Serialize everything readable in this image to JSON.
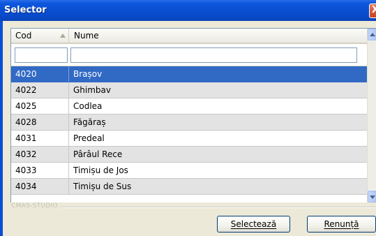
{
  "window": {
    "title": "Selector",
    "close_glyph": "X"
  },
  "grid": {
    "columns": [
      {
        "label": "Cod",
        "sorted": "ascending"
      },
      {
        "label": "Nume"
      }
    ],
    "filters": {
      "cod_value": "",
      "nume_value": ""
    },
    "rows": [
      {
        "cod": "4020",
        "nume": "Brașov",
        "selected": true
      },
      {
        "cod": "4022",
        "nume": "Ghimbav"
      },
      {
        "cod": "4025",
        "nume": "Codlea"
      },
      {
        "cod": "4028",
        "nume": "Făgăraș"
      },
      {
        "cod": "4031",
        "nume": "Predeal"
      },
      {
        "cod": "4032",
        "nume": "Pârâul Rece"
      },
      {
        "cod": "4033",
        "nume": "Timișu de Jos"
      },
      {
        "cod": "4034",
        "nume": "Timișu de Sus"
      }
    ]
  },
  "brand": "CMAS-STUDIO",
  "buttons": {
    "select_label": "Selectează",
    "cancel_label": "Renunță"
  },
  "colors": {
    "title_bar": "#0a4fd3",
    "selection": "#316ac5",
    "alt_row": "#e3e3e3"
  }
}
